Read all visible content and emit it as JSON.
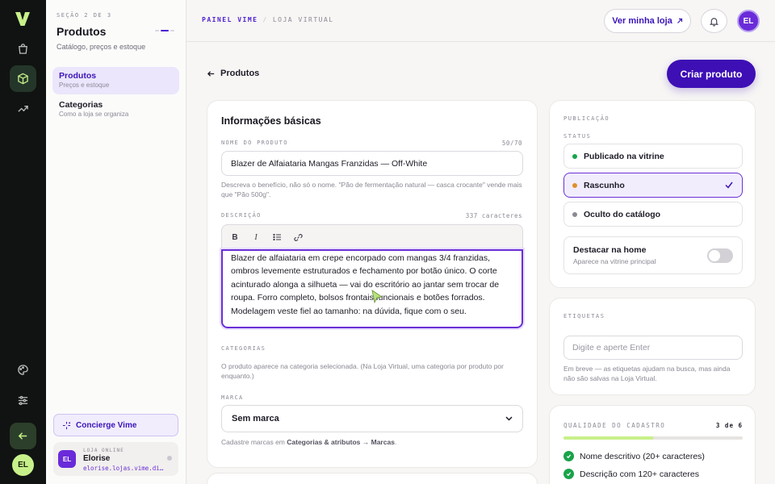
{
  "rail": {
    "logo": "V",
    "avatar": "EL",
    "items": [
      "bag-icon",
      "box-icon",
      "trend-icon",
      "palette-icon",
      "sliders-icon",
      "back-icon"
    ]
  },
  "sidebar": {
    "eyebrow": "SEÇÃO 2 DE 3",
    "title": "Produtos",
    "subtitle": "Catálogo, preços e estoque",
    "items": [
      {
        "label": "Produtos",
        "sub": "Preços e estoque"
      },
      {
        "label": "Categorias",
        "sub": "Como a loja se organiza"
      }
    ],
    "concierge": "Concierge Vime",
    "store": {
      "avatar": "EL",
      "kicker": "LOJA ONLINE",
      "name": "Elorise",
      "url": "elorise.lojas.vime.di…"
    }
  },
  "topbar": {
    "crumb1": "PAINEL VIME",
    "crumb_sep": "/",
    "crumb2": "LOJA VIRTUAL",
    "view_store": "Ver minha loja",
    "avatar": "EL"
  },
  "page": {
    "back_label": "Produtos",
    "create_label": "Criar produto"
  },
  "basic": {
    "title": "Informações básicas",
    "name_label": "NOME DO PRODUTO",
    "name_count": "50/70",
    "name_value": "Blazer de Alfaiataria Mangas Franzidas — Off-White",
    "name_help": "Descreva o benefício, não só o nome. \"Pão de fermentação natural — casca crocante\" vende mais que \"Pão 500g\".",
    "desc_label": "DESCRIÇÃO",
    "desc_count": "337 caracteres",
    "toolbar": {
      "bold": "B",
      "italic": "I"
    },
    "desc_value": "Blazer de alfaiataria em crepe encorpado com mangas 3/4 franzidas, ombros levemente estruturados e fechamento por botão único. O corte acinturado alonga a silhueta — vai do escritório ao jantar sem trocar de roupa. Forro completo, bolsos frontais funcionais e botões forrados. Modelagem veste fiel ao tamanho: na dúvida, fique com o seu.",
    "cat_label": "CATEGORIAS",
    "cat_help": "O produto aparece na categoria selecionada. (Na Loja Virtual, uma categoria por produto por enquanto.)",
    "brand_label": "MARCA",
    "brand_value": "Sem marca",
    "brand_help_pre": "Cadastre marcas em ",
    "brand_help_link": "Categorias & atributos → Marcas",
    "brand_help_post": "."
  },
  "publication": {
    "title": "PUBLICAÇÃO",
    "status_label": "STATUS",
    "options": [
      {
        "label": "Publicado na vitrine",
        "color": "#19a34a"
      },
      {
        "label": "Rascunho",
        "color": "#e0902a"
      },
      {
        "label": "Oculto do catálogo",
        "color": "#8c8995"
      }
    ],
    "feature_title": "Destacar na home",
    "feature_sub": "Aparece na vitrine principal"
  },
  "tags": {
    "title": "ETIQUETAS",
    "placeholder": "Digite e aperte Enter",
    "help": "Em breve — as etiquetas ajudam na busca, mas ainda não são salvas na Loja Virtual."
  },
  "quality": {
    "title": "QUALIDADE DO CADASTRO",
    "score": "3 de 6",
    "fraction": 0.5,
    "items": [
      "Nome descritivo (20+ caracteres)",
      "Descrição com 120+ caracteres"
    ]
  },
  "colors": {
    "accent": "#4d1fd1",
    "lime": "#c8f08a",
    "rail": "#101312"
  }
}
